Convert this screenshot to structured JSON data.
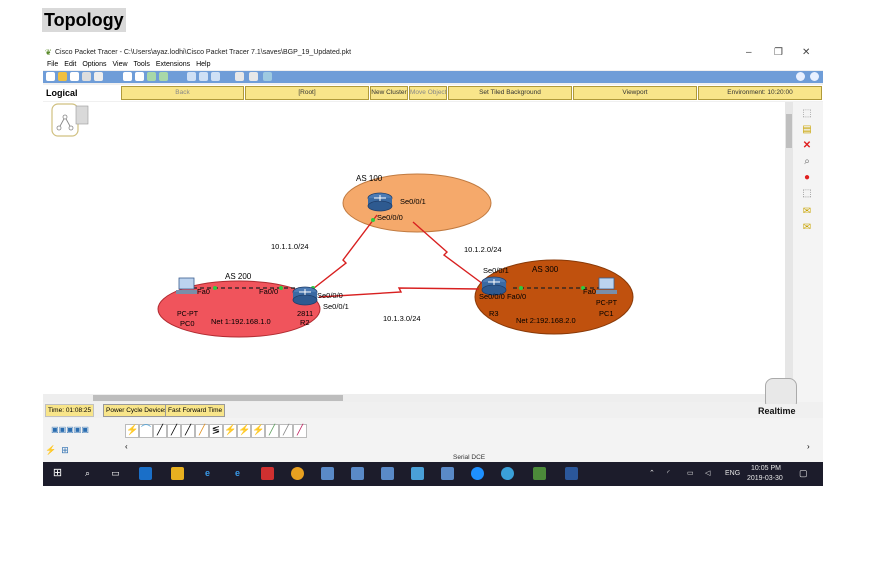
{
  "heading": "Topology",
  "window": {
    "title": "Cisco Packet Tracer - C:\\Users\\ayaz.lodhi\\Cisco Packet Tracer 7.1\\saves\\BGP_19_Updated.pkt",
    "minimize": "–",
    "maximize": "❐",
    "close": "✕"
  },
  "menu": [
    "File",
    "Edit",
    "Options",
    "View",
    "Tools",
    "Extensions",
    "Help"
  ],
  "nav": {
    "logical": "Logical",
    "back": "Back",
    "root": "[Root]",
    "new_cluster": "New Cluster",
    "move_object": "Move Object",
    "set_tiled_background": "Set Tiled Background",
    "viewport": "Viewport",
    "environment": "Environment: 10:20:00"
  },
  "topology": {
    "as100": {
      "label": "AS 100",
      "color": "#f5a96b"
    },
    "as200": {
      "label": "AS 200",
      "color": "#f0545c"
    },
    "as300": {
      "label": "AS 300",
      "color": "#c0510e"
    },
    "r1_iface_se001": "Se0/0/1",
    "r1_iface_se000": "Se0/0/0",
    "r2_iface_se000": "Se0/0/0",
    "r2_iface_se001": "Se0/0/1",
    "r2_iface_fa00": "Fa0/0",
    "r2_model": "2811",
    "r2_name": "R2",
    "r3_iface_se001": "Se0/0/1",
    "r3_iface_se000_fa00": "Se0/0/0 Fa0/0",
    "r3_name": "R3",
    "pc0_iface": "Fa0",
    "pc0_type": "PC-PT",
    "pc0_name": "PC0",
    "pc1_iface": "Fa0",
    "pc1_type": "PC-PT",
    "pc1_name": "PC1",
    "net1": "Net 1:192.168.1.0",
    "net2": "Net 2:192.168.2.0",
    "link_r1_r2": "10.1.1.0/24",
    "link_r1_r3": "10.1.2.0/24",
    "link_r2_r3": "10.1.3.0/24",
    "link_color": "#d82020"
  },
  "status": {
    "time": "Time: 01:08:25",
    "power_cycle": "Power Cycle Devices",
    "fast_forward": "Fast Forward Time",
    "realtime": "Realtime",
    "connection_type": "Serial DCE"
  },
  "taskbar": {
    "lang": "ENG",
    "time": "10:05 PM",
    "date": "2019-03-30"
  }
}
